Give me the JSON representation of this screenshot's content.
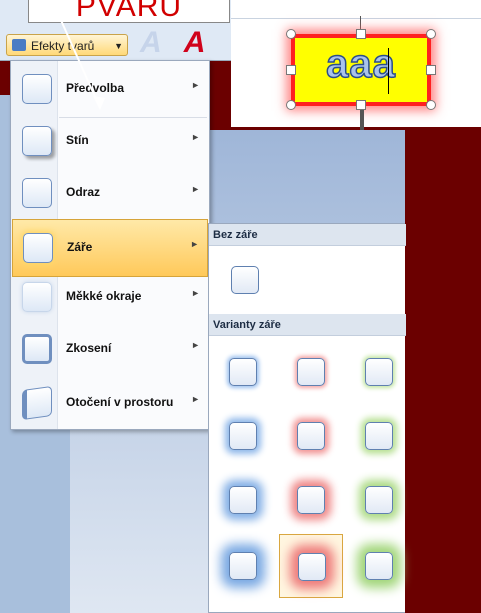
{
  "callout": {
    "text": "PVARU"
  },
  "ribbon": {
    "effects_label": "Efekty tvarů",
    "letters": "A A"
  },
  "preview": {
    "text": "aaa"
  },
  "menu": {
    "items": [
      {
        "label": "Předvolba"
      },
      {
        "label": "Stín"
      },
      {
        "label": "Odraz"
      },
      {
        "label": "Záře"
      },
      {
        "label": "Měkké okraje"
      },
      {
        "label": "Zkosení"
      },
      {
        "label": "Otočení v prostoru"
      }
    ]
  },
  "submenu": {
    "section1": "Bez záře",
    "section2": "Varianty záře",
    "glow_colors": [
      "#6f9fe0",
      "#f08080",
      "#a8d878"
    ],
    "selected": "row4-red"
  },
  "colors": {
    "callout": "#d10000",
    "highlight": "#ffc95a",
    "background": "#6b0000"
  }
}
